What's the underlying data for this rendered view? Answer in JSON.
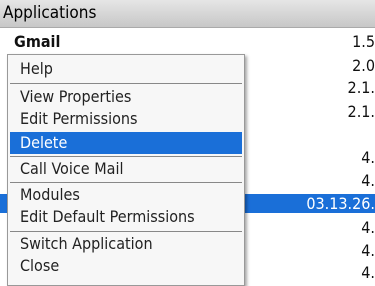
{
  "title": "Applications",
  "apps": [
    {
      "name": "Gmail",
      "version": "1.5"
    },
    {
      "name": "",
      "version": "2.0"
    },
    {
      "name": "",
      "version": "2.1."
    },
    {
      "name": "",
      "version": "2.1."
    },
    {
      "name": "",
      "version": "4."
    },
    {
      "name": "",
      "version": "4."
    },
    {
      "name": "",
      "version": "03.13.26."
    },
    {
      "name": "",
      "version": "4."
    },
    {
      "name": "",
      "version": "4."
    },
    {
      "name": "",
      "version": "4."
    }
  ],
  "selected_row_index": 6,
  "menu": {
    "items": [
      "Help",
      "View Properties",
      "Edit Permissions",
      "Delete",
      "Call Voice Mail",
      "Modules",
      "Edit Default Permissions",
      "Switch Application",
      "Close"
    ],
    "highlighted_index": 3
  },
  "colors": {
    "highlight": "#1a6fd8",
    "menu_bg": "#f7f7f7",
    "title_bg": "#d3d3d3"
  }
}
